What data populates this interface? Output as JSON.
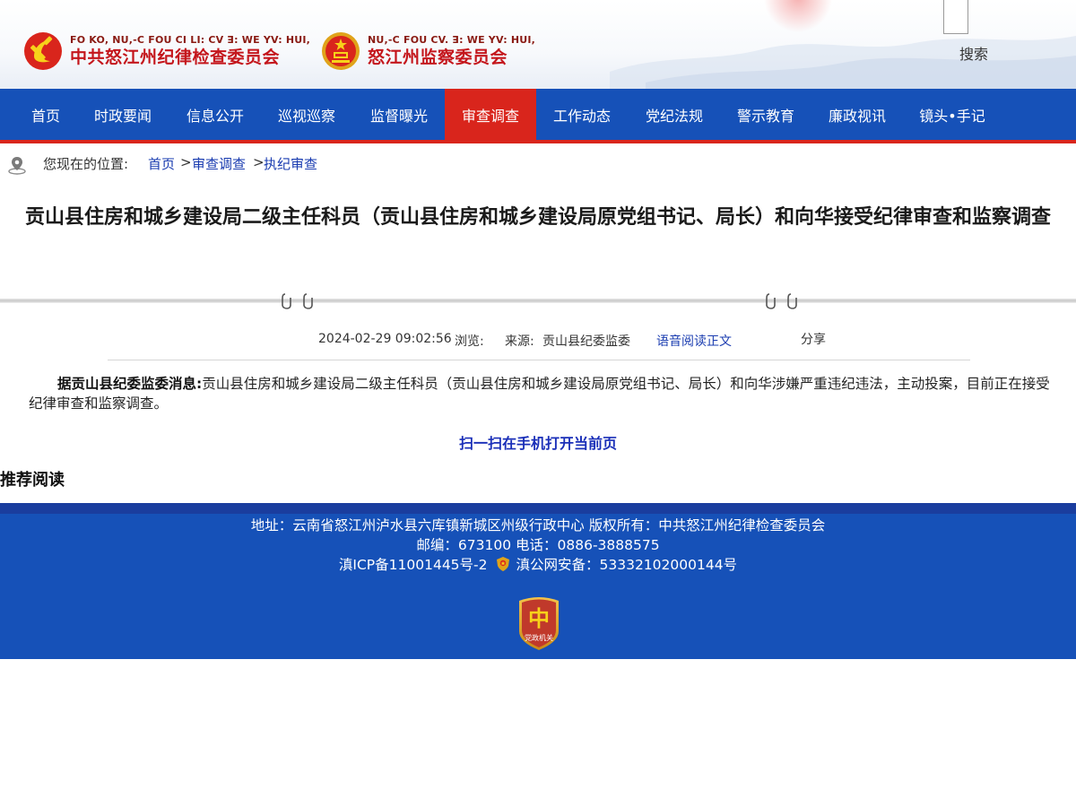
{
  "header": {
    "logo1": {
      "sub": "FO KO, NU,-C FOU CI LI: CV ꓱ: WE YV: HUI,",
      "main": "中共怒江州纪律检查委员会",
      "icon": "party-emblem-icon"
    },
    "logo2": {
      "sub": "NU,-C FOU CV. ꓱ: WE YV: HUI,",
      "main": "怒江州监察委员会",
      "icon": "national-emblem-icon"
    },
    "search_label": "搜索"
  },
  "nav": {
    "items": [
      {
        "label": "首页"
      },
      {
        "label": "时政要闻"
      },
      {
        "label": "信息公开"
      },
      {
        "label": "巡视巡察"
      },
      {
        "label": "监督曝光"
      },
      {
        "label": "审查调查",
        "active": true
      },
      {
        "label": "工作动态"
      },
      {
        "label": "党纪法规"
      },
      {
        "label": "警示教育"
      },
      {
        "label": "廉政视讯"
      },
      {
        "label": "镜头•手记"
      }
    ],
    "bg_color": "#1651b8",
    "active_color": "#d9251c"
  },
  "breadcrumb": {
    "label": "您现在的位置:",
    "items": [
      "首页",
      "审查调查",
      "执纪审查"
    ],
    "separator": ">"
  },
  "article": {
    "title": "贡山县住房和城乡建设局二级主任科员（贡山县住房和城乡建设局原党组书记、局长）和向华接受纪律审查和监察调查",
    "datetime": "2024-02-29 09:02:56",
    "views_label": "浏览:",
    "source_label": "来源:",
    "source": "贡山县纪委监委",
    "listen_label": "语音阅读正文",
    "share_label": "分享",
    "lead": "据贡山县纪委监委消息:",
    "body": "贡山县住房和城乡建设局二级主任科员（贡山县住房和城乡建设局原党组书记、局长）和向华涉嫌严重违纪违法，主动投案，目前正在接受纪律审查和监察调查。",
    "qr_label": "扫一扫在手机打开当前页",
    "recommend_label": "推荐阅读"
  },
  "footer": {
    "address_line": "地址：云南省怒江州泸水县六库镇新城区州级行政中心 版权所有：中共怒江州纪律检查委员会",
    "contact_line": "邮编：673100   电话：0886-3888575",
    "icp": "滇ICP备11001445号-2",
    "police_record": "滇公网安备：53332102000144号",
    "badge_text": "党政机关",
    "bg_color": "#1651b8"
  }
}
